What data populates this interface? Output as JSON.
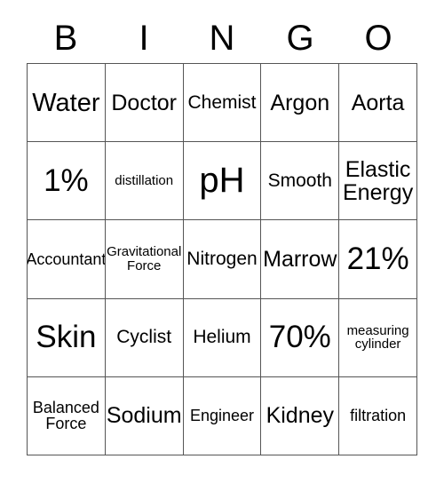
{
  "card": {
    "title": "BINGO",
    "header_letters": [
      "B",
      "I",
      "N",
      "G",
      "O"
    ],
    "grid_size": "5x5",
    "colors": {
      "background": "#ffffff",
      "text": "#000000",
      "grid_line": "#555555"
    },
    "rows": [
      [
        {
          "text": "Water",
          "size": "lg"
        },
        {
          "text": "Doctor",
          "size": "md"
        },
        {
          "text": "Chemist",
          "size": "sm"
        },
        {
          "text": "Argon",
          "size": "md"
        },
        {
          "text": "Aorta",
          "size": "md"
        }
      ],
      [
        {
          "text": "1%",
          "size": "xl"
        },
        {
          "text": "distillation",
          "size": "xxs"
        },
        {
          "text": "pH",
          "size": "xxl"
        },
        {
          "text": "Smooth",
          "size": "sm"
        },
        {
          "text": "Elastic\nEnergy",
          "size": "md"
        }
      ],
      [
        {
          "text": "Accountant",
          "size": "xs"
        },
        {
          "text": "Gravitational\nForce",
          "size": "xxs"
        },
        {
          "text": "Nitrogen",
          "size": "sm"
        },
        {
          "text": "Marrow",
          "size": "md"
        },
        {
          "text": "21%",
          "size": "xl"
        }
      ],
      [
        {
          "text": "Skin",
          "size": "xl"
        },
        {
          "text": "Cyclist",
          "size": "sm"
        },
        {
          "text": "Helium",
          "size": "sm"
        },
        {
          "text": "70%",
          "size": "xl"
        },
        {
          "text": "measuring\ncylinder",
          "size": "xxs"
        }
      ],
      [
        {
          "text": "Balanced\nForce",
          "size": "xs"
        },
        {
          "text": "Sodium",
          "size": "md"
        },
        {
          "text": "Engineer",
          "size": "xs"
        },
        {
          "text": "Kidney",
          "size": "md"
        },
        {
          "text": "filtration",
          "size": "xs"
        }
      ]
    ]
  }
}
